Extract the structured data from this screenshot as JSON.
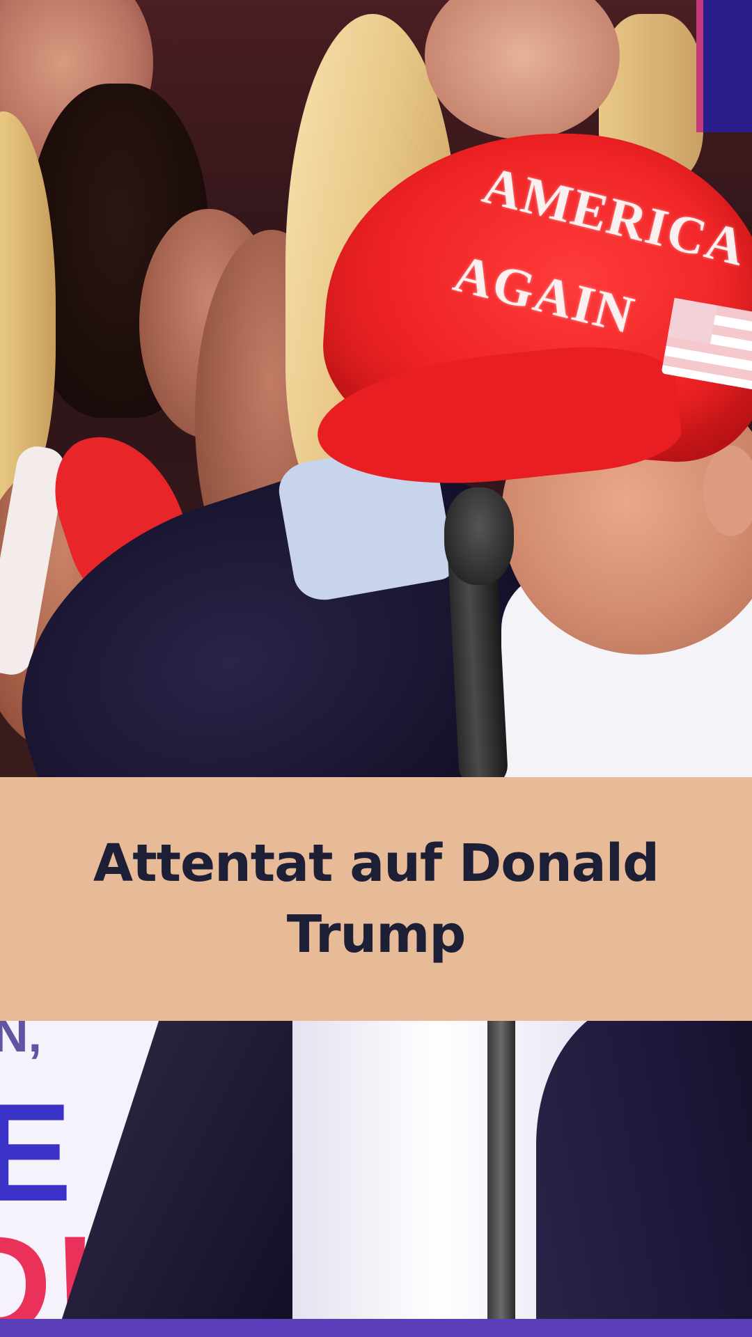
{
  "headline": {
    "line1": "Attentat auf Donald",
    "line2": "Trump"
  },
  "photo": {
    "cap_text_line1": "AMERICA",
    "cap_text_line2": "AGAIN",
    "sign_letters": [
      "E",
      "D!"
    ]
  },
  "colors": {
    "banner_background": "#e8bb98",
    "headline_text": "#1c1f35",
    "cap_red": "#ee2224",
    "sign_blue": "#3b32c8",
    "sign_red": "#e9315a",
    "bottom_strip": "#5b3fb8"
  }
}
